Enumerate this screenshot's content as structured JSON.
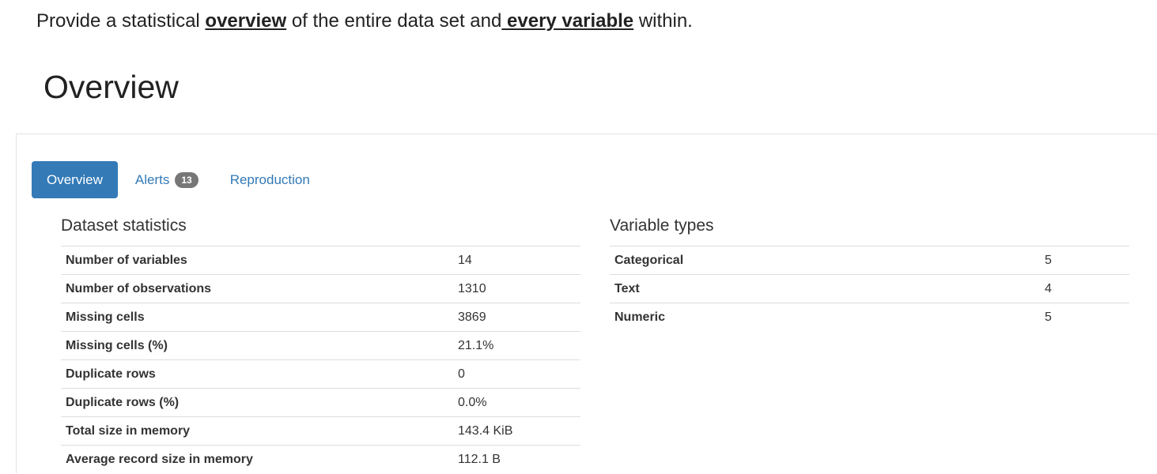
{
  "intro": {
    "before": "Provide a statistical ",
    "overview_word": "overview",
    "middle": " of the entire data set and",
    "every_variable": " every variable",
    "after": " within."
  },
  "page_title": "Overview",
  "tabs": [
    {
      "label": "Overview",
      "active": true
    },
    {
      "label": "Alerts",
      "badge": "13",
      "active": false
    },
    {
      "label": "Reproduction",
      "active": false
    }
  ],
  "dataset_statistics": {
    "title": "Dataset statistics",
    "rows": [
      {
        "label": "Number of variables",
        "value": "14"
      },
      {
        "label": "Number of observations",
        "value": "1310"
      },
      {
        "label": "Missing cells",
        "value": "3869"
      },
      {
        "label": "Missing cells (%)",
        "value": "21.1%"
      },
      {
        "label": "Duplicate rows",
        "value": "0"
      },
      {
        "label": "Duplicate rows (%)",
        "value": "0.0%"
      },
      {
        "label": "Total size in memory",
        "value": "143.4 KiB"
      },
      {
        "label": "Average record size in memory",
        "value": "112.1 B"
      }
    ]
  },
  "variable_types": {
    "title": "Variable types",
    "rows": [
      {
        "label": "Categorical",
        "value": "5"
      },
      {
        "label": "Text",
        "value": "4"
      },
      {
        "label": "Numeric",
        "value": "5"
      }
    ]
  },
  "colors": {
    "accent": "#337ab7",
    "badge": "#777777",
    "border": "#dddddd"
  }
}
